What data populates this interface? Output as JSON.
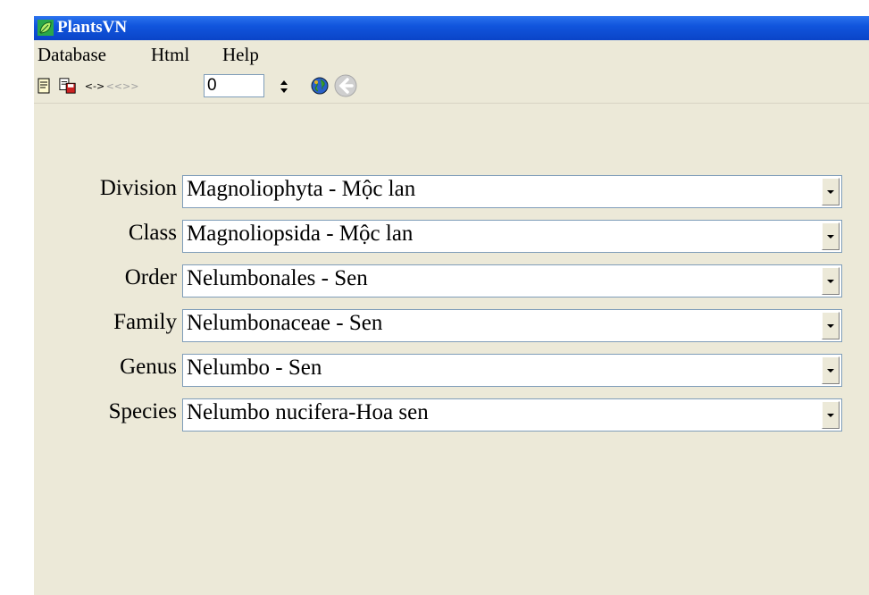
{
  "window": {
    "title": "PlantsVN"
  },
  "menu": [
    "Database",
    "Html",
    "Help"
  ],
  "toolbar": {
    "nav_label": "<->",
    "nav_disabled_label": "<<>>",
    "record_value": "0"
  },
  "fields": [
    {
      "label": "Division",
      "value": "Magnoliophyta - Mộc lan"
    },
    {
      "label": "Class",
      "value": "Magnoliopsida - Mộc lan"
    },
    {
      "label": "Order",
      "value": "Nelumbonales - Sen"
    },
    {
      "label": "Family",
      "value": "Nelumbonaceae - Sen"
    },
    {
      "label": "Genus",
      "value": "Nelumbo - Sen"
    },
    {
      "label": "Species",
      "value": "Nelumbo nucifera-Hoa sen"
    }
  ],
  "colors": {
    "titlebar": "#0a44c8",
    "window_bg": "#ece9d8",
    "field_border": "#7f9db9"
  }
}
